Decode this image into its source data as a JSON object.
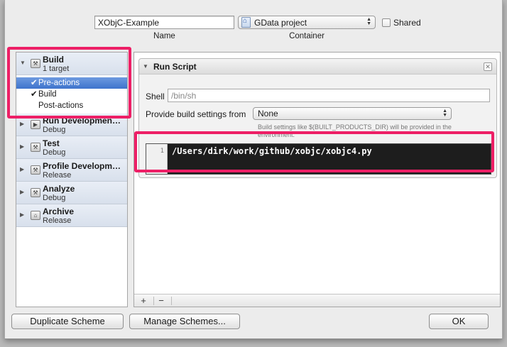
{
  "header": {
    "name_value": "XObjC-Example",
    "name_caption": "Name",
    "container_value": "GData project",
    "container_caption": "Container",
    "shared_label": "Shared"
  },
  "sidebar": {
    "items": [
      {
        "label": "Build",
        "sub": "1 target"
      },
      {
        "label": "Run Developmen…",
        "sub": "Debug"
      },
      {
        "label": "Test",
        "sub": "Debug"
      },
      {
        "label": "Profile Developm…",
        "sub": "Release"
      },
      {
        "label": "Analyze",
        "sub": "Debug"
      },
      {
        "label": "Archive",
        "sub": "Release"
      }
    ],
    "build_subitems": [
      "Pre-actions",
      "Build",
      "Post-actions"
    ]
  },
  "run_script": {
    "title": "Run Script",
    "shell_label": "Shell",
    "shell_value": "/bin/sh",
    "provide_label": "Provide build settings from",
    "provide_value": "None",
    "hint": "Build settings like $(BUILT_PRODUCTS_DIR) will be provided in the environment.",
    "line_number": "1",
    "script": "/Users/dirk/work/github/xobjc/xobjc4.py"
  },
  "bottom_bar": {
    "add": "+",
    "remove": "−"
  },
  "buttons": {
    "duplicate": "Duplicate Scheme",
    "manage": "Manage Schemes...",
    "ok": "OK"
  },
  "colors": {
    "highlight": "#ed1f66",
    "selection": "#3e73cc"
  }
}
